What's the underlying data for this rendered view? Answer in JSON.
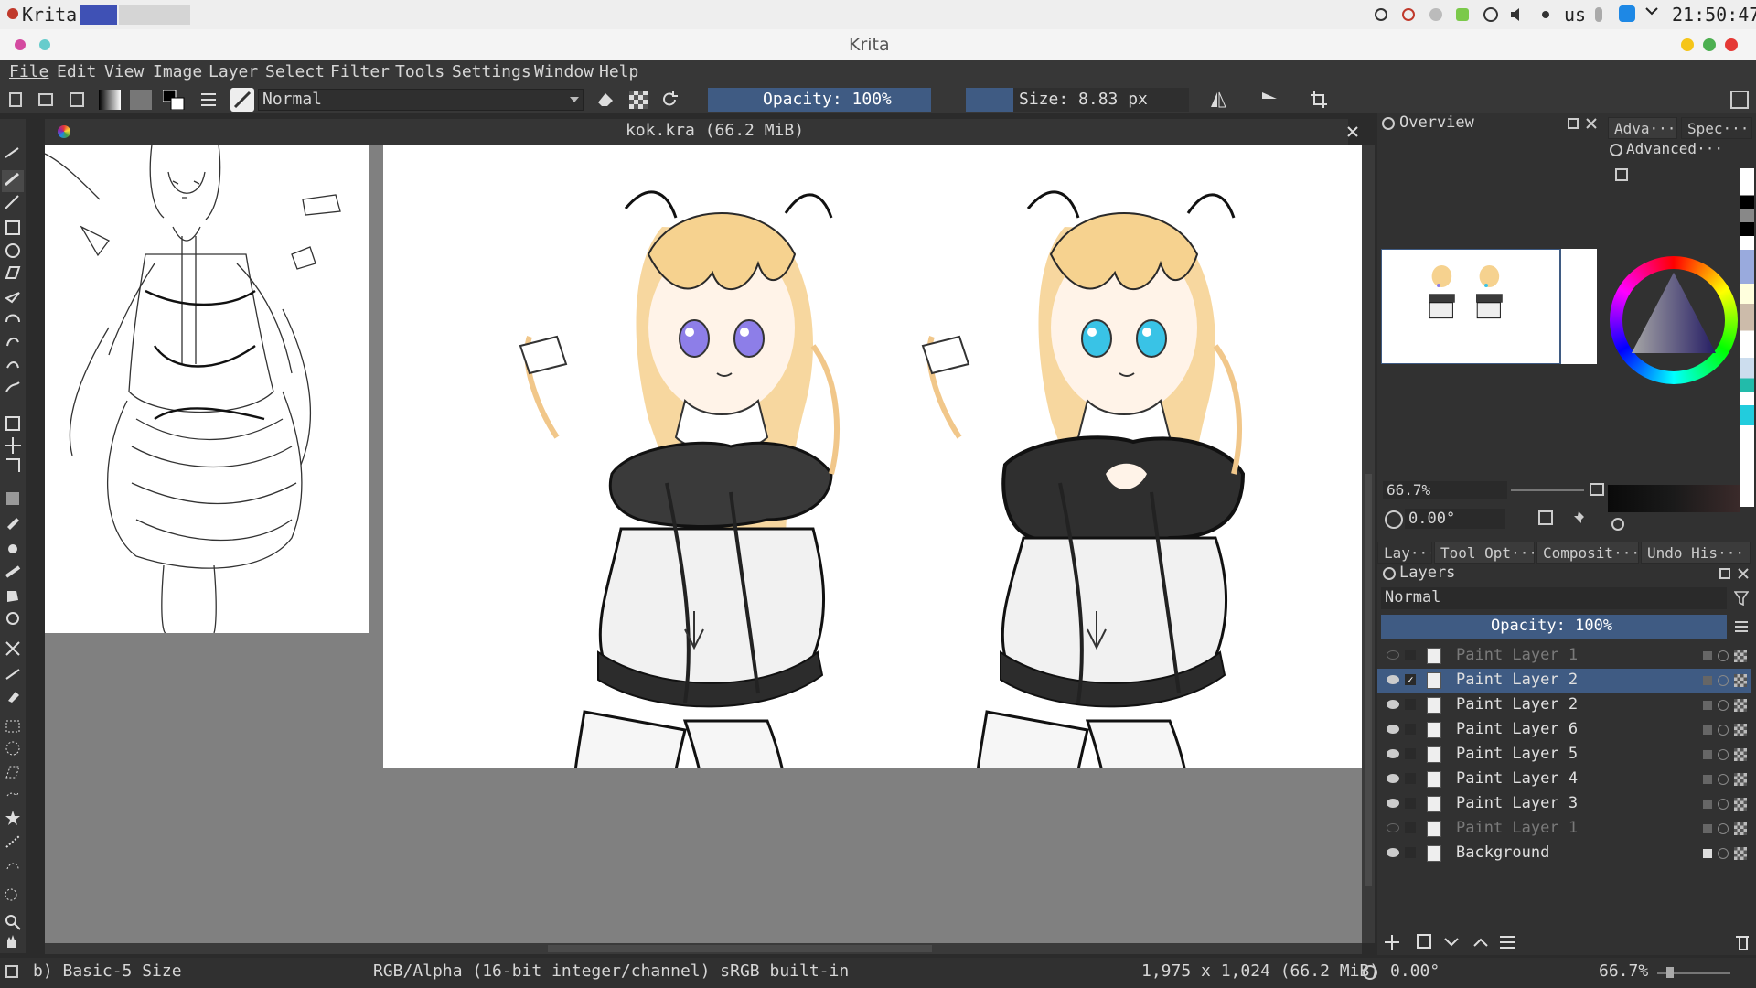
{
  "system": {
    "app_label": "Krita",
    "layout": "us",
    "clock": "21:50:47"
  },
  "window": {
    "title": "Krita"
  },
  "menu": [
    "File",
    "Edit",
    "View",
    "Image",
    "Layer",
    "Select",
    "Filter",
    "Tools",
    "Settings",
    "Window",
    "Help"
  ],
  "toolbar": {
    "blend_mode": "Normal",
    "opacity": "Opacity: 100%",
    "size": "Size: 8.83 px"
  },
  "document": {
    "tab_title": "kok.kra (66.2 MiB)"
  },
  "dockers": {
    "overview_title": "Overview",
    "tab_advanced": "Adva···",
    "tab_specific": "Spec···",
    "advanced_title": "Advanced···",
    "zoom": "66.7%",
    "rotation": "0.00°",
    "tabs": [
      "Lay···",
      "Tool Opt···",
      "Composit···",
      "Undo His···"
    ],
    "layers_title": "Layers",
    "layers_blend": "Normal",
    "layers_opacity": "Opacity:  100%"
  },
  "layers": [
    {
      "name": "Paint Layer 1",
      "visible": false,
      "selected": false,
      "checked": false
    },
    {
      "name": "Paint Layer 2",
      "visible": true,
      "selected": true,
      "checked": true
    },
    {
      "name": "Paint Layer 2",
      "visible": true,
      "selected": false,
      "checked": false
    },
    {
      "name": "Paint Layer 6",
      "visible": true,
      "selected": false,
      "checked": false
    },
    {
      "name": "Paint Layer 5",
      "visible": true,
      "selected": false,
      "checked": false
    },
    {
      "name": "Paint Layer 4",
      "visible": true,
      "selected": false,
      "checked": false
    },
    {
      "name": "Paint Layer 3",
      "visible": true,
      "selected": false,
      "checked": false
    },
    {
      "name": "Paint Layer 1",
      "visible": false,
      "selected": false,
      "checked": false
    },
    {
      "name": "Background",
      "visible": true,
      "selected": false,
      "checked": false
    }
  ],
  "status": {
    "brush": "b) Basic-5 Size",
    "color_space": "RGB/Alpha (16-bit integer/channel)  sRGB built-in",
    "dimensions": "1,975 x 1,024 (66.2 MiB)",
    "rotation": "0.00°",
    "zoom": "66.7%"
  },
  "colors": {
    "accent": "#3f5b83",
    "hair": "#f6d8a0",
    "eye_left": "#8d7ee8",
    "eye_right": "#39c3e6"
  }
}
